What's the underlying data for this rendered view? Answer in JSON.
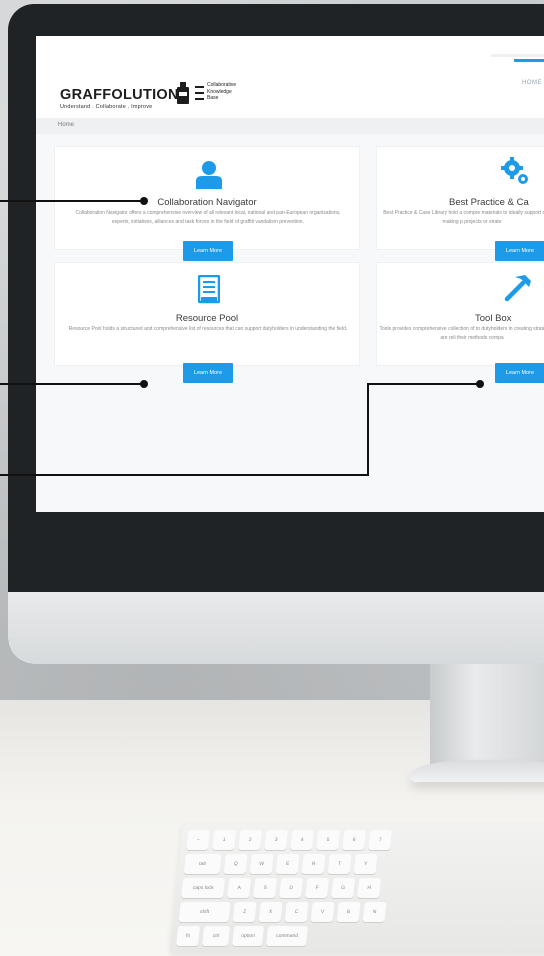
{
  "site": {
    "logo_name": "GRAFFOLUTION",
    "logo_tagline": "Understand . Collaborate . Improve",
    "logo_kb_lines": [
      "Collaborative",
      "Knowledge",
      "Base"
    ],
    "nav_home": "HOME",
    "breadcrumb_home": "Home"
  },
  "cards": [
    {
      "icon": "person-icon",
      "title": "Collaboration Navigator",
      "desc": "Collaboration Navigator offers a comprehensive overview of all relevant local, national and pan-European organisations, experts, initiatives, alliances and task forces in the field of graffiti vandalism prevention.",
      "button": "Learn More"
    },
    {
      "icon": "gears-icon",
      "title": "Best Practice & Ca",
      "desc": "Best Practice & Case Library hold a compre materials to ideally support decision making p projects or strate",
      "button": "Learn More"
    },
    {
      "icon": "file-cabinet-icon",
      "title": "Resource Pool",
      "desc": "Resource Pool holds a structured and comprehensive list of resources that can support dutyholders in understanding the field.",
      "button": "Learn More"
    },
    {
      "icon": "hammer-icon",
      "title": "Tool Box",
      "desc": "Tools provides comprehensive collection of to dutyholders in creating strategies that are reli their methods compa",
      "button": "Learn More"
    }
  ],
  "keyboard": {
    "row1": [
      "~",
      "1",
      "2",
      "3",
      "4",
      "5",
      "6",
      "7"
    ],
    "row2": [
      "tab",
      "Q",
      "W",
      "E",
      "R",
      "T",
      "Y"
    ],
    "row3": [
      "caps lock",
      "A",
      "S",
      "D",
      "F",
      "G",
      "H"
    ],
    "row4": [
      "shift",
      "Z",
      "X",
      "C",
      "V",
      "B",
      "N"
    ],
    "row5": [
      "fn",
      "ctrl",
      "option",
      "command"
    ]
  },
  "colors": {
    "accent": "#1d9be8",
    "bezel": "#1f2326",
    "page_bg": "#f7f8f9"
  }
}
